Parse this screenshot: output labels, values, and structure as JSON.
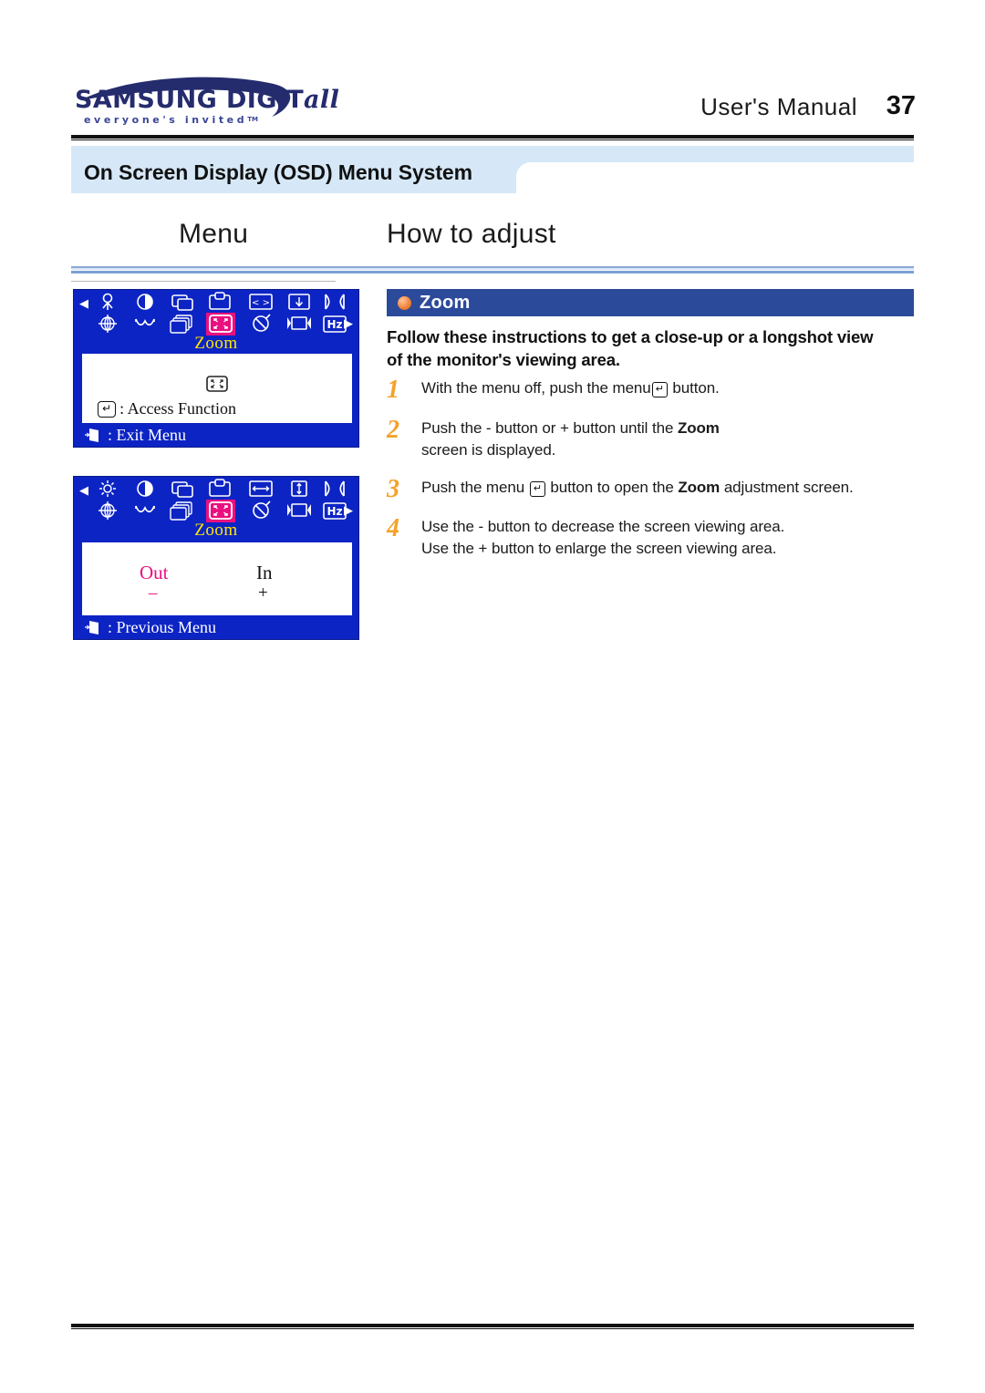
{
  "header": {
    "logo_main": "SAMSUNG DIGIT",
    "logo_main_italic": "all",
    "logo_sub": "everyone's invited",
    "logo_sub_tm": "TM",
    "manual_label": "User's  Manual",
    "page_number": "37"
  },
  "section": {
    "title": "On Screen Display (OSD) Menu System",
    "col_menu": "Menu",
    "col_how": "How to adjust"
  },
  "osd_screens": [
    {
      "name": "zoom-menu-screen",
      "label": "Zoom",
      "access_text": ": Access Function",
      "bottom_text": ": Exit Menu",
      "icons_row1": [
        "person-icon",
        "contrast-icon",
        "image-position-icon",
        "image-size-icon",
        "h-position-icon",
        "v-position-icon",
        "pincushion-icon"
      ],
      "icons_row2": [
        "rotation-icon",
        "trapezoid-icon",
        "layers-icon",
        "zoom-icon",
        "degauss-icon",
        "h-centering-icon",
        "hz-icon"
      ],
      "highlighted_icon": "zoom-icon"
    },
    {
      "name": "zoom-adjust-screen",
      "label": "Zoom",
      "out_label": "Out",
      "out_sign": "–",
      "in_label": "In",
      "in_sign": "+",
      "bottom_text": ": Previous Menu",
      "icons_row1": [
        "brightness-icon",
        "contrast-icon",
        "image-position-icon",
        "image-size-icon",
        "h-size-icon",
        "v-size-icon",
        "pincushion-icon"
      ],
      "icons_row2": [
        "rotation-icon",
        "trapezoid-icon",
        "layers-icon",
        "zoom-icon",
        "degauss-icon",
        "h-centering-icon",
        "hz-icon"
      ],
      "highlighted_icon": "zoom-icon"
    }
  ],
  "panel": {
    "heading": "Zoom",
    "bullet_icon": "orange-sphere-bullet",
    "lead_line1": "Follow these instructions to get a close-up or a longshot view",
    "lead_line2": "of the monitor's viewing area.",
    "steps": [
      {
        "number": "1",
        "pre": "With the menu off, push the menu",
        "key": "↵",
        "post": " button.",
        "line2": ""
      },
      {
        "number": "2",
        "pre": "Push the  - button or  + button until the ",
        "bold": "Zoom",
        "post": "",
        "line2": "screen is displayed."
      },
      {
        "number": "3",
        "pre": "Push the menu ",
        "key": "↵",
        "mid": " button to open the ",
        "bold": "Zoom",
        "post": " adjustment screen.",
        "line2": ""
      },
      {
        "number": "4",
        "pre": "Use the  - button to decrease the screen viewing area.",
        "line2": "Use the  + button to enlarge the screen viewing area."
      }
    ]
  },
  "colors": {
    "osd_blue": "#0d24c4",
    "osd_highlight": "#ea1080",
    "osd_label_yellow": "#ffe600",
    "panel_bar_blue": "#2c4a9a",
    "band_light_blue": "#d6e8f7",
    "step_number_orange": "#f5a12a",
    "logo_navy": "#252c6e"
  }
}
